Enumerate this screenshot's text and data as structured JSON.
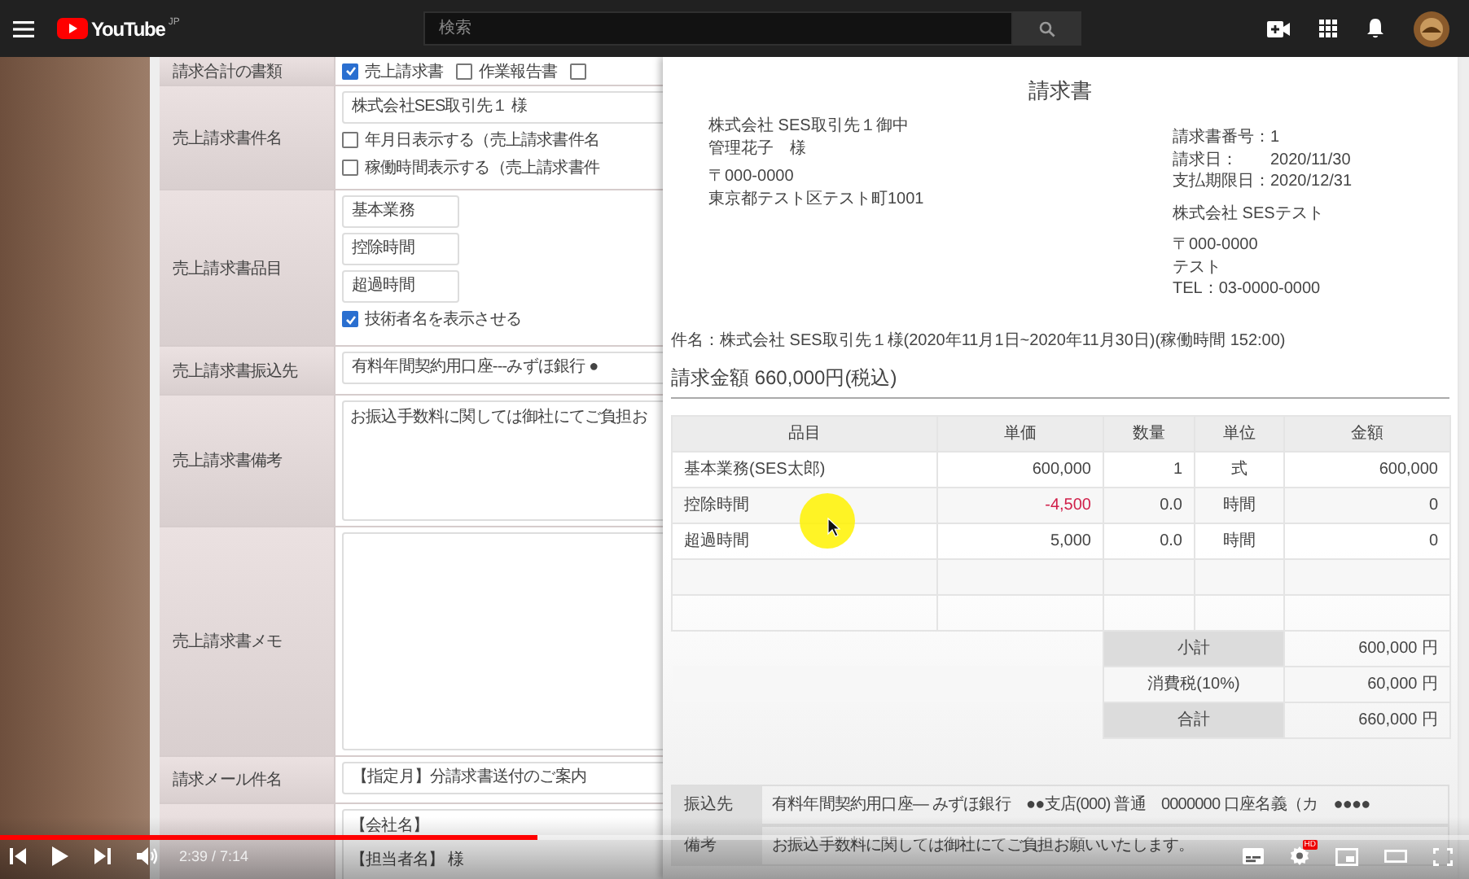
{
  "topbar": {
    "logo": "YouTube",
    "region": "JP",
    "search": {
      "placeholder": "検索"
    }
  },
  "form": {
    "rows": [
      {
        "label": "請求合計の書類",
        "fields": [
          {
            "kind": "checkbox",
            "label": "売上請求書",
            "checked": true
          },
          {
            "kind": "checkbox",
            "label": "作業報告書",
            "checked": false
          },
          {
            "kind": "checkbox",
            "checked": false
          }
        ]
      },
      {
        "label": "売上請求書件名",
        "fields": [
          {
            "kind": "input",
            "value": "株式会社SES取引先１ 様"
          },
          {
            "kind": "checkbox",
            "label": "年月日表示する（売上請求書件名",
            "checked": false
          },
          {
            "kind": "checkbox",
            "label": "稼働時間表示する（売上請求書件",
            "checked": false
          }
        ]
      },
      {
        "label": "売上請求書品目",
        "fields": [
          {
            "kind": "input",
            "value": "基本業務"
          },
          {
            "kind": "input",
            "value": "控除時間"
          },
          {
            "kind": "input",
            "value": "超過時間"
          },
          {
            "kind": "checkbox",
            "label": "技術者名を表示させる",
            "checked": true
          }
        ]
      },
      {
        "label": "売上請求書振込先",
        "fields": [
          {
            "kind": "select",
            "value": "有料年間契約用口座---みずほ銀行 ●"
          }
        ]
      },
      {
        "label": "売上請求書備考",
        "fields": [
          {
            "kind": "textarea",
            "lines": [
              "お振込手数料に関しては御社にてご負担お"
            ]
          }
        ]
      },
      {
        "label": "売上請求書メモ",
        "fields": [
          {
            "kind": "textarea"
          }
        ]
      },
      {
        "label": "請求メール件名",
        "fields": [
          {
            "kind": "input",
            "value": "【指定月】分請求書送付のご案内"
          }
        ]
      },
      {
        "fields": [
          {
            "kind": "textarea",
            "lines": [
              "【会社名】",
              "【担当者名】 様"
            ]
          }
        ]
      }
    ]
  },
  "invoice": {
    "title": "請求書",
    "to": [
      "株式会社 SES取引先１御中",
      "管理花子　様",
      "〒000-0000",
      "東京都テスト区テスト町1001"
    ],
    "meta": [
      {
        "label": "請求書番号：",
        "value": "1"
      },
      {
        "label": "請求日：",
        "value": "2020/11/30"
      },
      {
        "label": "支払期限日：",
        "value": "2020/12/31"
      }
    ],
    "from": [
      "株式会社 SESテスト",
      "〒000-0000",
      "テスト",
      "TEL：03-0000-0000"
    ],
    "subject": "件名：株式会社 SES取引先１様(2020年11月1日~2020年11月30日)(稼働時間 152:00)",
    "total": "請求金額 660,000円(税込)",
    "table": {
      "columns": [
        "品目",
        "単価",
        "数量",
        "単位",
        "金額"
      ],
      "rows": [
        {
          "cells": [
            "基本業務(SES太郎)",
            "600,000",
            "1",
            "式",
            "600,000"
          ],
          "negative": false
        },
        {
          "cells": [
            "控除時間",
            "-4,500",
            "0.0",
            "時間",
            "0"
          ],
          "negative": true
        },
        {
          "cells": [
            "超過時間",
            "5,000",
            "0.0",
            "時間",
            "0"
          ],
          "negative": false
        }
      ]
    },
    "summary": [
      {
        "label": "小計",
        "value": "600,000 円"
      },
      {
        "label": "消費税(10%)",
        "value": "60,000 円"
      },
      {
        "label": "合計",
        "value": "660,000 円"
      }
    ],
    "footer": [
      {
        "label": "振込先",
        "value": "有料年間契約用口座― みずほ銀行　●●支店(000) 普通　0000000 口座名義（カ　●●●●"
      },
      {
        "label": "備考",
        "value": "お振込手数料に関しては御社にてご負担お願いいたします。"
      }
    ]
  },
  "player": {
    "time": "2:39 / 7:14",
    "progress": {
      "level": 0.366
    },
    "settings_badge": "HD"
  }
}
